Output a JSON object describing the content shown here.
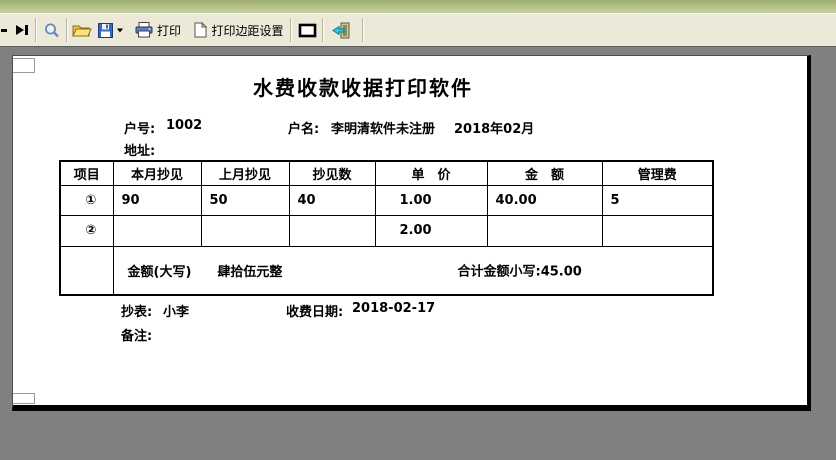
{
  "toolbar": {
    "print_label": "打印",
    "margin_label": "打印边距设置",
    "icons": {
      "prev_fragment": "prev-page-fragment",
      "last_page": "play-to-bar",
      "zoom": "magnifier",
      "open": "folder-open",
      "save": "floppy-disk",
      "save_dropdown": "caret-down",
      "print": "printer",
      "margin": "document-page",
      "page_border": "square-outline",
      "exit": "door-with-arrow"
    }
  },
  "doc": {
    "title": "水费收款收据打印软件",
    "fields": {
      "account_label": "户号:",
      "account": "1002",
      "name_label": "户名:",
      "name": "李明清软件未注册",
      "period": "2018年02月",
      "address_label": "地址:",
      "address": "",
      "reader_label": "抄表:",
      "reader": "小李",
      "date_label": "收费日期:",
      "date": "2018-02-17",
      "remark_label": "备注:",
      "remark": ""
    },
    "table": {
      "headers": [
        "项目",
        "本月抄见",
        "上月抄见",
        "抄见数",
        "单　价",
        "金　额",
        "管理费"
      ],
      "rows": [
        [
          "①",
          "90",
          "50",
          "40",
          "1.00",
          "40.00",
          "5"
        ],
        [
          "②",
          "",
          "",
          "",
          "2.00",
          "",
          ""
        ]
      ],
      "summary": {
        "amount_words_label": "金额(大写)",
        "amount_words": "肆拾伍元整",
        "total_label": "合计金额小写:",
        "total": "45.00"
      }
    }
  },
  "colors": {
    "top_band_dark": "#9fae72",
    "top_band_light": "#c9d2a2",
    "toolbar_bg": "#ece9d8",
    "preview_bg": "#808080",
    "page_bg": "#ffffff",
    "page_shadow": "#000000",
    "text": "#000000"
  }
}
